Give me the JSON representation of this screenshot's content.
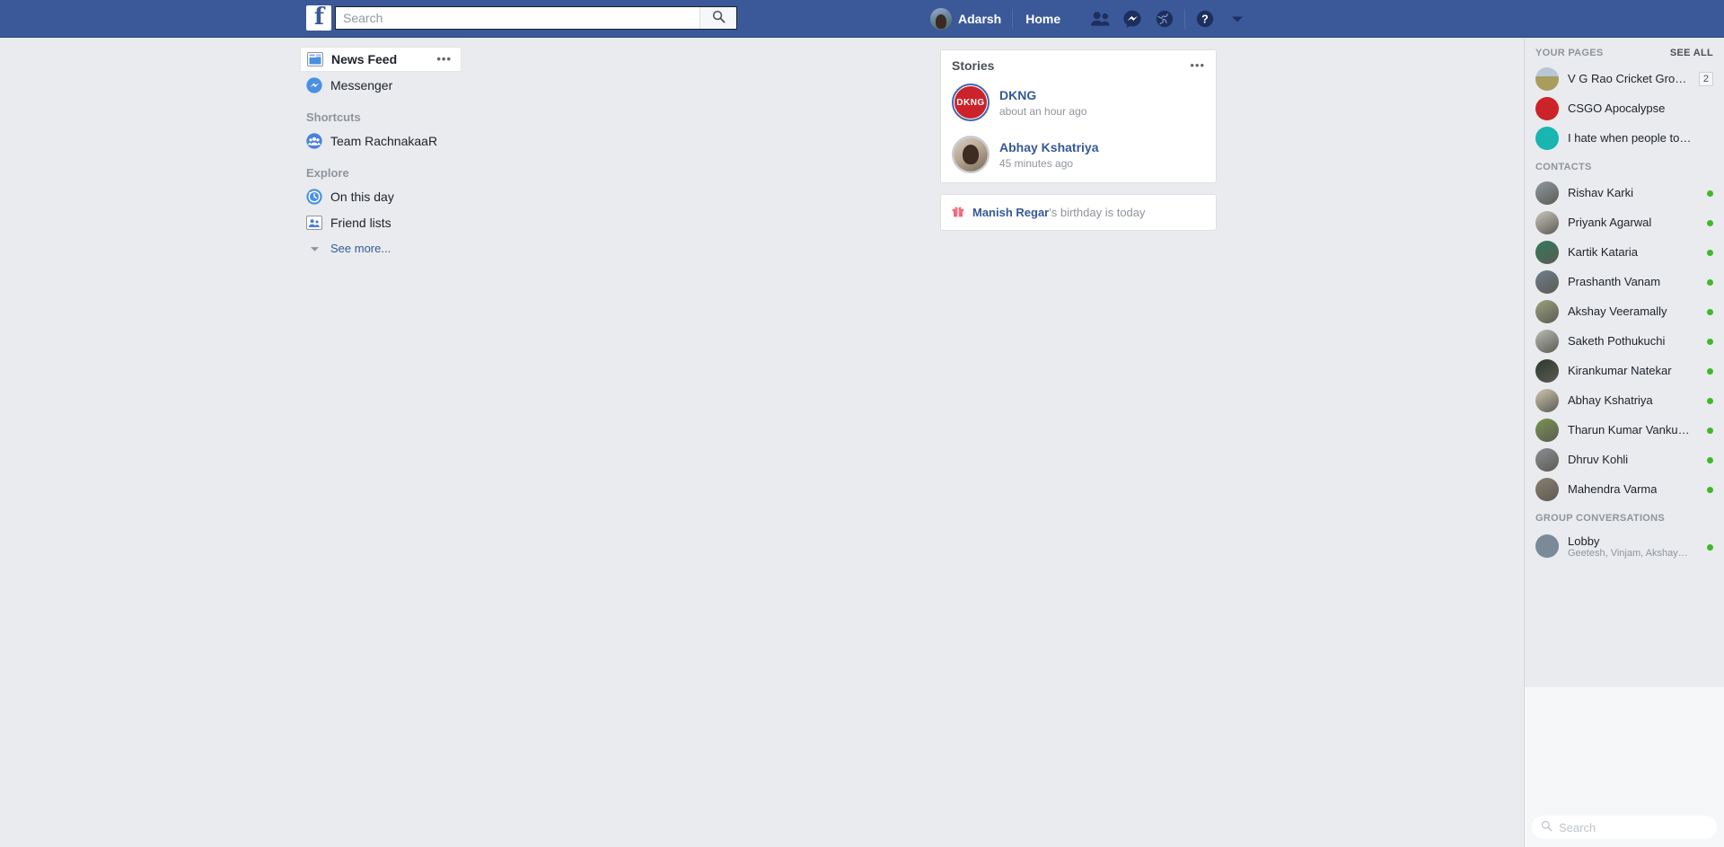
{
  "header": {
    "logo_letter": "f",
    "search": {
      "value": "",
      "placeholder": "Search"
    },
    "profile_name": "Adarsh",
    "home_label": "Home",
    "icons": [
      "friend-requests-icon",
      "messenger-icon",
      "notifications-globe-icon",
      "help-icon",
      "account-dropdown-icon"
    ]
  },
  "left_nav": {
    "items": [
      {
        "label": "News Feed",
        "icon": "news-feed-icon",
        "active": true,
        "has_menu": true
      },
      {
        "label": "Messenger",
        "icon": "messenger-icon",
        "active": false,
        "has_menu": false
      }
    ],
    "shortcuts_heading": "Shortcuts",
    "shortcuts": [
      {
        "label": "Team RachnakaaR",
        "icon": "group-icon"
      }
    ],
    "explore_heading": "Explore",
    "explore": [
      {
        "label": "On this day",
        "icon": "on-this-day-clock-icon"
      },
      {
        "label": "Friend lists",
        "icon": "friend-lists-icon"
      }
    ],
    "see_more": "See more..."
  },
  "center": {
    "stories": {
      "title": "Stories",
      "menu": "•••",
      "items": [
        {
          "name": "DKNG",
          "time": "about an hour ago",
          "avatar": "dkng-logo",
          "unseen": true
        },
        {
          "name": "Abhay Kshatriya",
          "time": "45 minutes ago",
          "avatar": "abhay-photo",
          "unseen": false
        }
      ]
    },
    "birthday": {
      "icon": "gift-icon",
      "name": "Manish Regar",
      "suffix": "'s birthday is today"
    }
  },
  "rail": {
    "pages_heading": "YOUR PAGES",
    "see_all": "SEE ALL",
    "pages": [
      {
        "name": "V G Rao Cricket Ground",
        "badge": "2",
        "color": "#b9a66a"
      },
      {
        "name": "CSGO Apocalypse",
        "badge": "",
        "color": "#cc2229"
      },
      {
        "name": "I hate when people touch …",
        "badge": "",
        "color": "#19b5b0"
      }
    ],
    "contacts_heading": "CONTACTS",
    "contacts": [
      {
        "name": "Rishav Karki",
        "online": true,
        "color": "#8d9aa2"
      },
      {
        "name": "Priyank Agarwal",
        "online": true,
        "color": "#c9c6bd"
      },
      {
        "name": "Kartik Kataria",
        "online": true,
        "color": "#2f7a5b"
      },
      {
        "name": "Prashanth Vanam",
        "online": true,
        "color": "#6f7e8c"
      },
      {
        "name": "Akshay Veeramally",
        "online": true,
        "color": "#9aa27e"
      },
      {
        "name": "Saketh Pothukuchi",
        "online": true,
        "color": "#b7bdb2"
      },
      {
        "name": "Kirankumar Natekar",
        "online": true,
        "color": "#2b3a2c"
      },
      {
        "name": "Abhay Kshatriya",
        "online": true,
        "color": "#cfc6ae"
      },
      {
        "name": "Tharun Kumar Vanku…",
        "online": true,
        "color": "#79954f"
      },
      {
        "name": "Dhruv Kohli",
        "online": true,
        "color": "#8a8f94"
      },
      {
        "name": "Mahendra Varma",
        "online": true,
        "color": "#8a7f6e"
      }
    ],
    "groups_heading": "GROUP CONVERSATIONS",
    "groups": [
      {
        "name": "Lobby",
        "members": "Geetesh, Vinjam, Akshay…",
        "online": true,
        "color": "#7b8a99"
      }
    ]
  },
  "chat_dock": {
    "search": {
      "value": "",
      "placeholder": "Search"
    },
    "tools": [
      "gear-icon",
      "compose-icon",
      "add-people-icon"
    ]
  }
}
